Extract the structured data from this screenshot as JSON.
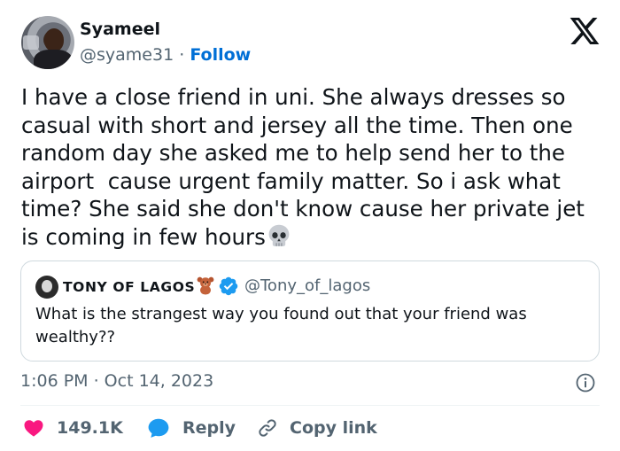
{
  "author": {
    "name": "Syameel",
    "handle": "@syame31",
    "separator": "·",
    "follow_label": "Follow",
    "avatar_icon": "profile-photo"
  },
  "platform_icon": "x-logo-icon",
  "tweet": {
    "text": "I have a close friend in uni. She always dresses so casual with short and jersey all the time. Then one random day she asked me to help send her to the airport  cause urgent family matter. So i ask what time? She said she don't know cause her private jet is coming in few hours",
    "emoji": "skull-emoji"
  },
  "quoted": {
    "name": "TONY OF LAGOS",
    "name_emoji": "teddy-bear-emoji",
    "verified": true,
    "handle": "@Tony_of_lagos",
    "text": "What is the strangest way you found out that your friend was wealthy??"
  },
  "timestamp": "1:06 PM · Oct 14, 2023",
  "actions": {
    "likes": "149.1K",
    "reply_label": "Reply",
    "copy_label": "Copy link"
  },
  "colors": {
    "link_blue": "#006fd6",
    "like_red": "#f91880",
    "reply_blue": "#1d9bf0",
    "muted": "#536471",
    "verified_blue": "#1d9bf0"
  }
}
